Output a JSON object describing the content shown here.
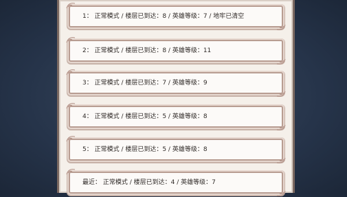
{
  "records": [
    {
      "text": "1： 正常模式 / 楼层已到达：8 / 英雄等级：7 /  地牢已清空"
    },
    {
      "text": "2： 正常模式 / 楼层已到达：8 / 英雄等级：11"
    },
    {
      "text": "3： 正常模式 / 楼层已到达：7 / 英雄等级：9"
    },
    {
      "text": "4： 正常模式 / 楼层已到达：5 / 英雄等级：8"
    },
    {
      "text": "5： 正常模式 / 楼层已到达：5 / 英雄等级：8"
    },
    {
      "text": "最近： 正常模式 / 楼层已到达：4 / 英雄等级：7"
    }
  ]
}
